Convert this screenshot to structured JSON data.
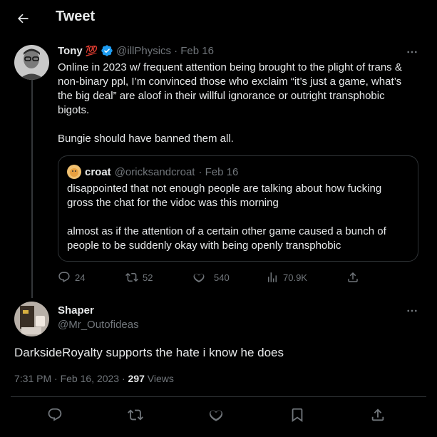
{
  "header": {
    "title": "Tweet"
  },
  "tweet": {
    "author_name": "Tony",
    "author_emoji": "💯",
    "handle": "@illPhysics",
    "date": "· Feb 16",
    "lines": [
      "Online in 2023 w/ frequent attention being brought to the plight of trans &",
      "non-binary ppl, I’m convinced those who exclaim “it’s just a game, what’s",
      "the big deal” are aloof in their willful ignorance or outright transphobic",
      "bigots.",
      "Bungie should have banned them all."
    ],
    "quote": {
      "author_name": "croat",
      "handle": "@oricksandcroat",
      "date": "· Feb 16",
      "lines": [
        "disappointed that not enough people are talking about how fucking",
        "gross the chat for the vidoc was this morning",
        "almost as if the attention of a certain other game caused a bunch of",
        "people to be suddenly okay with being openly transphobic"
      ]
    },
    "actions": {
      "replies": "24",
      "retweets": "52",
      "likes": "540",
      "views": "70.9K"
    }
  },
  "reply": {
    "author_name": "Shaper",
    "handle": "@Mr_Outofideas",
    "text": "DarksideRoyalty supports the hate i know he does",
    "timestamp": "7:31 PM · Feb 16, 2023 ·",
    "views_count": "297",
    "views_label": "Views"
  },
  "colors": {
    "background": "#000000",
    "text": "#e7e9ea",
    "muted": "#71767b",
    "accent": "#1d9bf0",
    "border": "#2f3336"
  },
  "icons": [
    "back-arrow-icon",
    "verified-badge-icon",
    "more-icon",
    "reply-icon",
    "retweet-icon",
    "like-icon",
    "views-icon",
    "share-icon",
    "bookmark-icon"
  ]
}
